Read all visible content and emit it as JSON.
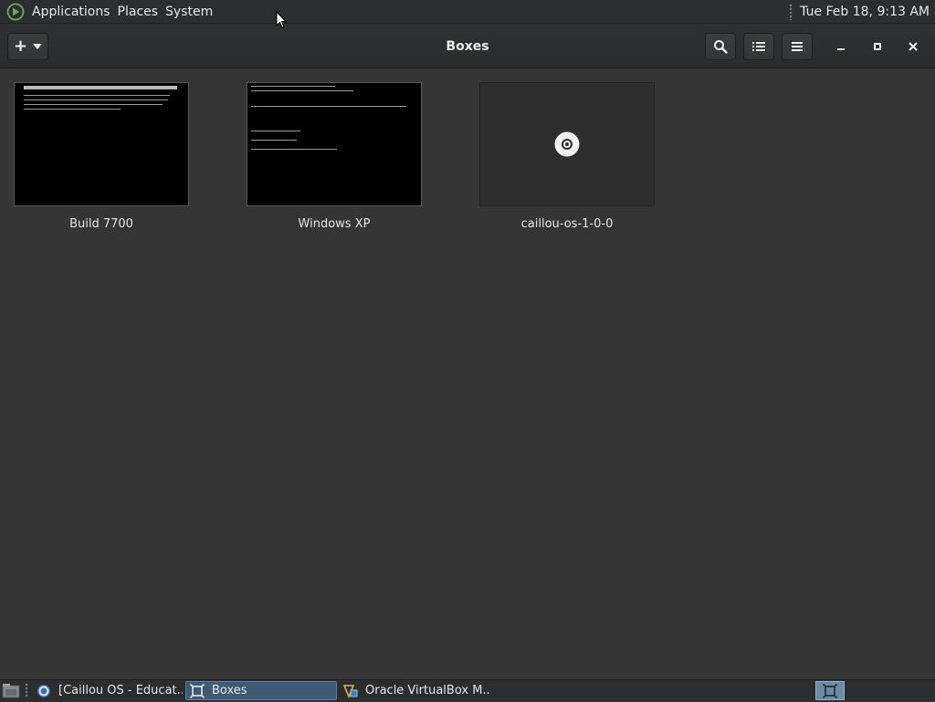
{
  "top_panel": {
    "menus": [
      "Applications",
      "Places",
      "System"
    ],
    "clock": "Tue Feb 18,  9:13 AM"
  },
  "headerbar": {
    "title": "Boxes",
    "new_button_glyph": "+",
    "icons": {
      "new": "plus-icon",
      "dropdown": "chevron-down-icon",
      "search": "search-icon",
      "view": "list-view-icon",
      "menu": "hamburger-menu-icon",
      "minimize": "minimize-icon",
      "maximize": "maximize-icon",
      "close": "close-icon"
    }
  },
  "boxes": [
    {
      "name": "Build 7700",
      "thumbnail": "error-screen",
      "icon": "vm-thumbnail"
    },
    {
      "name": "Windows XP",
      "thumbnail": "boot-screen",
      "icon": "vm-thumbnail"
    },
    {
      "name": "caillou-os-1-0-0",
      "thumbnail": "placeholder",
      "icon": "disc-icon"
    }
  ],
  "taskbar": {
    "tasks": [
      {
        "label": "[Caillou OS - Educat...",
        "icon": "browser-icon",
        "active": false
      },
      {
        "label": "Boxes",
        "icon": "boxes-icon",
        "active": true
      },
      {
        "label": "Oracle VirtualBox M...",
        "icon": "virtualbox-icon",
        "active": false
      }
    ],
    "workspace_icon": "boxes-icon"
  },
  "colors": {
    "panel_bg": "#2b2d2e",
    "content_bg": "#353535",
    "active_task": "#3e5a74",
    "workspace": "#6a8aa6"
  }
}
